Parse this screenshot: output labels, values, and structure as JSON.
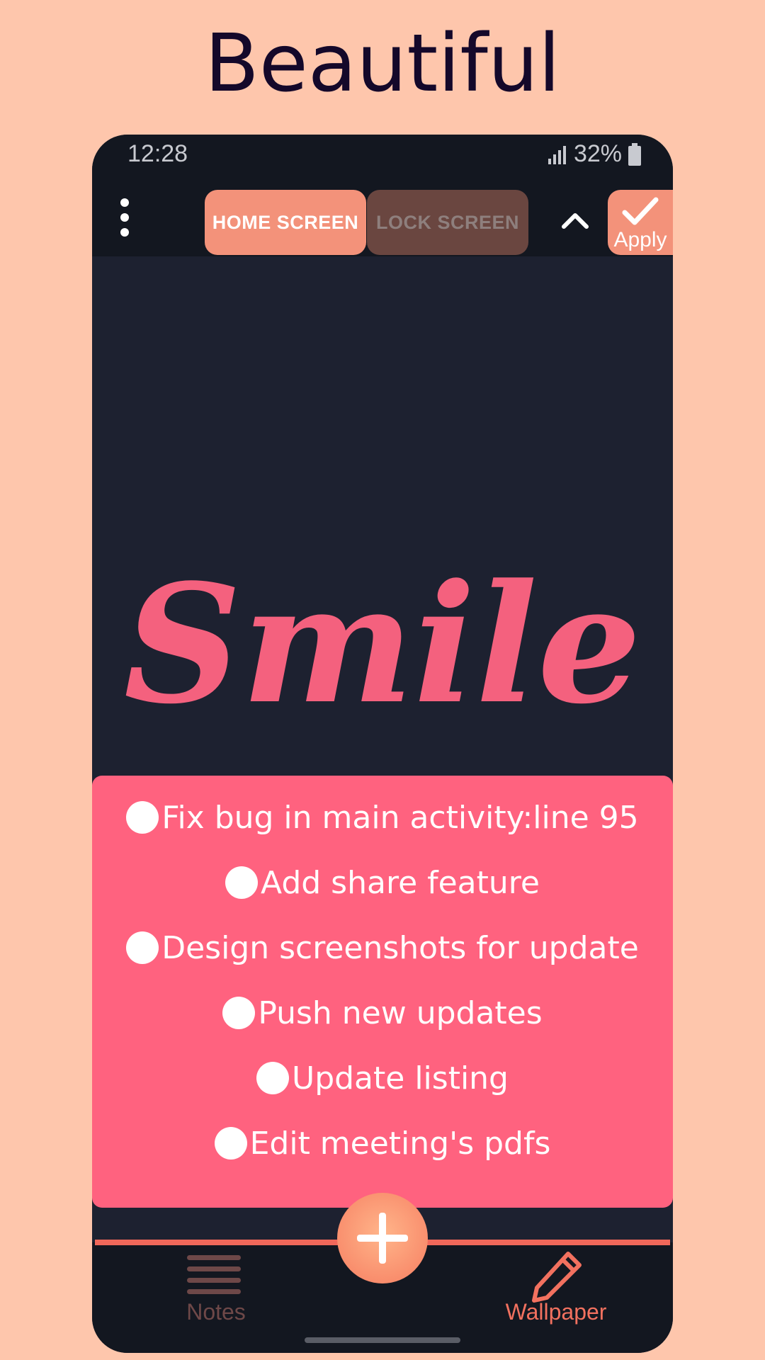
{
  "headline": "Beautiful",
  "status_bar": {
    "time": "12:28",
    "battery": "32%"
  },
  "toolbar": {
    "tabs": [
      {
        "label": "HOME SCREEN",
        "selected": true
      },
      {
        "label": "LOCK SCREEN",
        "selected": false
      }
    ],
    "apply_label": "Apply"
  },
  "wallpaper": {
    "title": "Smile"
  },
  "notes": {
    "items": [
      "Fix bug in main activity:line 95",
      "Add share feature",
      "Design screenshots for update",
      "Push new updates",
      "Update listing",
      "Edit meeting's pdfs"
    ]
  },
  "bottom_nav": {
    "items": [
      {
        "label": "Notes",
        "icon": "menu-lines-icon",
        "active": false
      },
      {
        "label": "Wallpaper",
        "icon": "pencil-icon",
        "active": true
      }
    ],
    "fab_icon": "plus-icon"
  },
  "colors": {
    "page_background": "#FEC6AC",
    "accent": "#F3927A",
    "notes_card": "#FF627F",
    "smile_text": "#F4617E",
    "phone_background": "#1D2130"
  }
}
